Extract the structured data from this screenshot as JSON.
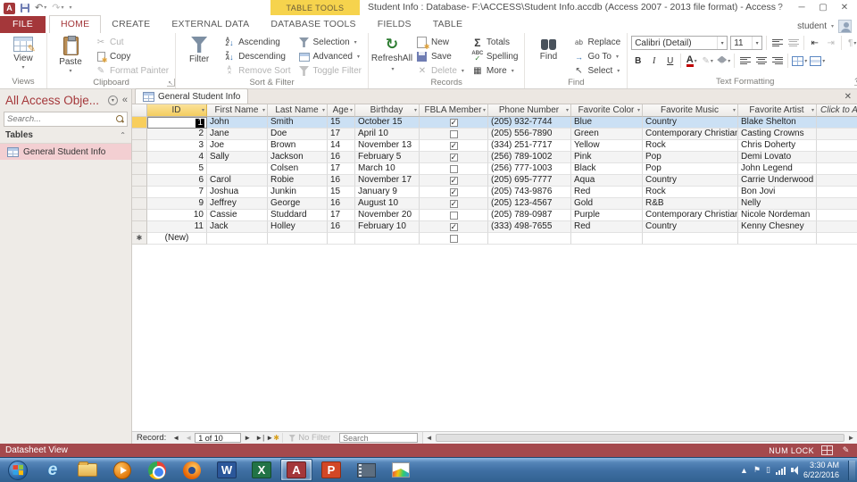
{
  "titlebar": {
    "title": "Student Info : Database- F:\\ACCESS\\Student Info.accdb (Access 2007 - 2013 file format) - Access",
    "contextual_header": "TABLE TOOLS",
    "help": "?"
  },
  "account": {
    "user": "student"
  },
  "ribbon": {
    "tabs": [
      {
        "label": "FILE"
      },
      {
        "label": "HOME"
      },
      {
        "label": "CREATE"
      },
      {
        "label": "EXTERNAL DATA"
      },
      {
        "label": "DATABASE TOOLS"
      },
      {
        "label": "FIELDS"
      },
      {
        "label": "TABLE"
      }
    ],
    "views": {
      "title": "Views",
      "view": "View"
    },
    "clipboard": {
      "title": "Clipboard",
      "paste": "Paste",
      "cut": "Cut",
      "copy": "Copy",
      "format_painter": "Format Painter"
    },
    "sort_filter": {
      "title": "Sort & Filter",
      "filter": "Filter",
      "ascending": "Ascending",
      "descending": "Descending",
      "remove_sort": "Remove Sort",
      "selection": "Selection",
      "advanced": "Advanced",
      "toggle_filter": "Toggle Filter"
    },
    "records": {
      "title": "Records",
      "refresh_line1": "Refresh",
      "refresh_line2": "All",
      "new": "New",
      "save": "Save",
      "delete": "Delete",
      "totals": "Totals",
      "spelling": "Spelling",
      "more": "More"
    },
    "find": {
      "title": "Find",
      "find": "Find",
      "replace": "Replace",
      "go_to": "Go To",
      "select": "Select"
    },
    "text_formatting": {
      "title": "Text Formatting",
      "font_name": "Calibri (Detail)",
      "font_size": "11",
      "bold": "B",
      "italic": "I",
      "underline": "U"
    }
  },
  "nav_pane": {
    "title": "All Access Obje...",
    "search_placeholder": "Search...",
    "section": "Tables",
    "items": [
      {
        "label": "General Student Info",
        "selected": true
      }
    ]
  },
  "document": {
    "tab": "General Student Info",
    "columns": [
      "ID",
      "First Name",
      "Last Name",
      "Age",
      "Birthday",
      "FBLA Member",
      "Phone Number",
      "Favorite Color",
      "Favorite Music",
      "Favorite Artist"
    ],
    "add_column": "Click to Add",
    "new_row_label": "(New)",
    "rows": [
      {
        "id": "1",
        "first": "John",
        "last": "Smith",
        "age": "15",
        "birthday": "October 15",
        "fbla": true,
        "phone": "(205) 932-7744",
        "color": "Blue",
        "music": "Country",
        "artist": "Blake Shelton"
      },
      {
        "id": "2",
        "first": "Jane",
        "last": "Doe",
        "age": "17",
        "birthday": "April 10",
        "fbla": false,
        "phone": "(205) 556-7890",
        "color": "Green",
        "music": "Contemporary Christian",
        "artist": "Casting Crowns"
      },
      {
        "id": "3",
        "first": "Joe",
        "last": "Brown",
        "age": "14",
        "birthday": "November 13",
        "fbla": true,
        "phone": "(334) 251-7717",
        "color": "Yellow",
        "music": "Rock",
        "artist": "Chris Doherty"
      },
      {
        "id": "4",
        "first": "Sally",
        "last": "Jackson",
        "age": "16",
        "birthday": "February 5",
        "fbla": true,
        "phone": "(256) 789-1002",
        "color": "Pink",
        "music": "Pop",
        "artist": "Demi Lovato"
      },
      {
        "id": "5",
        "first": "",
        "last": "Colsen",
        "age": "17",
        "birthday": "March 10",
        "fbla": false,
        "phone": "(256) 777-1003",
        "color": "Black",
        "music": "Pop",
        "artist": "John Legend"
      },
      {
        "id": "6",
        "first": "Carol",
        "last": "Robie",
        "age": "16",
        "birthday": "November 17",
        "fbla": true,
        "phone": "(205) 695-7777",
        "color": "Aqua",
        "music": "Country",
        "artist": "Carrie Underwood"
      },
      {
        "id": "7",
        "first": "Joshua",
        "last": "Junkin",
        "age": "15",
        "birthday": "January 9",
        "fbla": true,
        "phone": "(205) 743-9876",
        "color": "Red",
        "music": "Rock",
        "artist": "Bon Jovi"
      },
      {
        "id": "9",
        "first": "Jeffrey",
        "last": "George",
        "age": "16",
        "birthday": "August 10",
        "fbla": true,
        "phone": "(205) 123-4567",
        "color": "Gold",
        "music": "R&B",
        "artist": "Nelly"
      },
      {
        "id": "10",
        "first": "Cassie",
        "last": "Studdard",
        "age": "17",
        "birthday": "November 20",
        "fbla": false,
        "phone": "(205) 789-0987",
        "color": "Purple",
        "music": "Contemporary Christian",
        "artist": "Nicole Nordeman"
      },
      {
        "id": "11",
        "first": "Jack",
        "last": "Holley",
        "age": "16",
        "birthday": "February 10",
        "fbla": true,
        "phone": "(333) 498-7655",
        "color": "Red",
        "music": "Country",
        "artist": "Kenny Chesney"
      }
    ]
  },
  "record_nav": {
    "label": "Record:",
    "position": "1 of 10",
    "no_filter": "No Filter",
    "search_placeholder": "Search"
  },
  "status_bar": {
    "view_label": "Datasheet View",
    "num_lock": "NUM LOCK"
  },
  "taskbar": {
    "icons": [
      "start",
      "internet-explorer",
      "file-explorer",
      "media-player",
      "chrome",
      "firefox",
      "word",
      "excel",
      "access",
      "powerpoint",
      "film",
      "movie-maker"
    ],
    "active_icon": "access",
    "time": "3:30 AM",
    "date": "6/22/2016"
  },
  "colors": {
    "accent": "#A4373A",
    "contextual_tab": "#F6D34D",
    "selected_row": "#CBE0F4",
    "selected_header": "#F3CD5F",
    "status_bar": "#A4494D"
  }
}
